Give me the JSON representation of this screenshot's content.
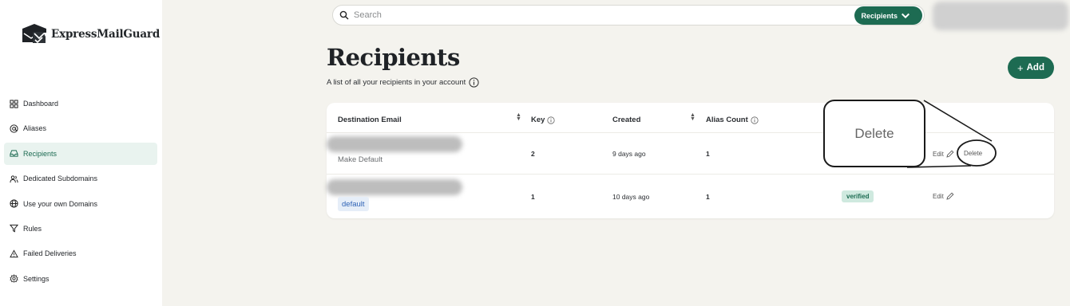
{
  "app": {
    "name": "ExpressMailGuard"
  },
  "sidebar": {
    "items": [
      {
        "label": "Dashboard",
        "icon": "dashboard-icon"
      },
      {
        "label": "Aliases",
        "icon": "at-icon"
      },
      {
        "label": "Recipients",
        "icon": "inbox-icon",
        "active": true
      },
      {
        "label": "Dedicated Subdomains",
        "icon": "users-icon"
      },
      {
        "label": "Use your own Domains",
        "icon": "globe-icon"
      },
      {
        "label": "Rules",
        "icon": "filter-icon"
      },
      {
        "label": "Failed Deliveries",
        "icon": "warning-icon"
      },
      {
        "label": "Settings",
        "icon": "gear-icon"
      }
    ]
  },
  "search": {
    "placeholder": "Search",
    "scope": "Recipients"
  },
  "page": {
    "title": "Recipients",
    "subtitle": "A list of all your recipients in your account",
    "add_label": "Add"
  },
  "table": {
    "columns": [
      "Destination Email",
      "Key",
      "Created",
      "Alias Count"
    ],
    "rows": [
      {
        "email_action": "Make Default",
        "key": "2",
        "created": "9 days ago",
        "alias_count": "1",
        "status": "",
        "edit": "Edit",
        "delete": "Delete"
      },
      {
        "email_badge": "default",
        "key": "1",
        "created": "10 days ago",
        "alias_count": "1",
        "status": "verified",
        "edit": "Edit"
      }
    ]
  },
  "callout": {
    "label": "Delete"
  },
  "colors": {
    "accent": "#1d6b52",
    "background": "#f4f3ee"
  }
}
